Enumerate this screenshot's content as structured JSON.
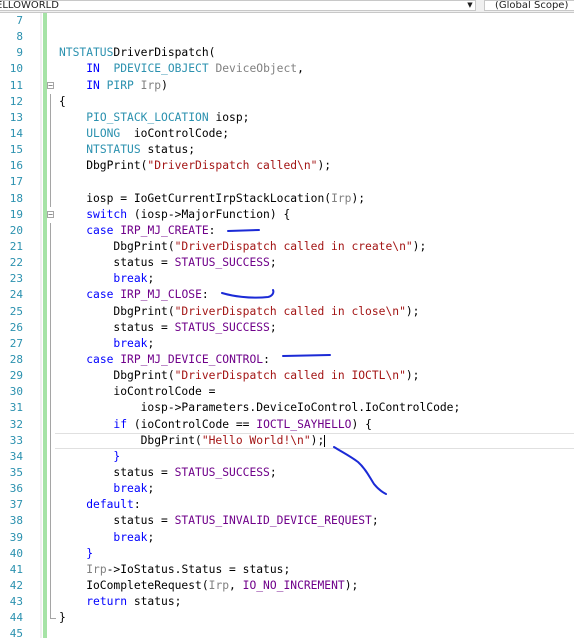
{
  "toolbar": {
    "scope_dropdown": "ELLOWORLD",
    "member_dropdown": "(Global Scope)"
  },
  "editor": {
    "line_numbers": [
      "7",
      "8",
      "9",
      "10",
      "11",
      "12",
      "13",
      "14",
      "15",
      "16",
      "17",
      "18",
      "19",
      "20",
      "21",
      "22",
      "23",
      "24",
      "25",
      "26",
      "27",
      "28",
      "29",
      "30",
      "31",
      "32",
      "33",
      "34",
      "35",
      "36",
      "37",
      "38",
      "39",
      "40",
      "41",
      "42",
      "43",
      "44",
      "45"
    ],
    "lines": [
      [],
      [],
      [
        [
          "ty",
          "NTSTATUS"
        ],
        [
          "",
          "DriverDispatch("
        ]
      ],
      [
        [
          "",
          "    "
        ],
        [
          "kw",
          "IN"
        ],
        [
          "",
          ""
        ],
        [
          "",
          "  "
        ],
        [
          "ty",
          "PDEVICE_OBJECT"
        ],
        [
          "",
          ""
        ],
        [
          "pa",
          " DeviceObject"
        ],
        [
          "",
          ","
        ]
      ],
      [
        [
          "",
          "    "
        ],
        [
          "kw",
          "IN"
        ],
        [
          "",
          ""
        ],
        [
          "ty",
          " PIRP"
        ],
        [
          "pa",
          " Irp"
        ],
        [
          "",
          ")"
        ]
      ],
      [
        [
          "",
          "{"
        ]
      ],
      [
        [
          "",
          "    "
        ],
        [
          "ty",
          "PIO_STACK_LOCATION"
        ],
        [
          "",
          " iosp;"
        ]
      ],
      [
        [
          "",
          "    "
        ],
        [
          "ty",
          "ULONG"
        ],
        [
          "",
          "  ioControlCode;"
        ]
      ],
      [
        [
          "",
          "    "
        ],
        [
          "ty",
          "NTSTATUS"
        ],
        [
          "",
          " status;"
        ]
      ],
      [
        [
          "",
          "    DbgPrint("
        ],
        [
          "st",
          "\"DriverDispatch called\\n\""
        ],
        [
          "",
          ");"
        ]
      ],
      [],
      [
        [
          "",
          "    iosp = IoGetCurrentIrpStackLocation("
        ],
        [
          "pa",
          "Irp"
        ],
        [
          "",
          ");"
        ]
      ],
      [
        [
          "",
          "    "
        ],
        [
          "kw",
          "switch"
        ],
        [
          "",
          " (iosp->MajorFunction) {"
        ]
      ],
      [
        [
          "",
          "    "
        ],
        [
          "kw",
          "case"
        ],
        [
          "",
          " "
        ],
        [
          "pr",
          "IRP_MJ_CREATE"
        ],
        [
          "",
          ":"
        ]
      ],
      [
        [
          "",
          "        DbgPrint("
        ],
        [
          "st",
          "\"DriverDispatch called in create\\n\""
        ],
        [
          "",
          ");"
        ]
      ],
      [
        [
          "",
          "        status = "
        ],
        [
          "pr",
          "STATUS_SUCCESS"
        ],
        [
          "",
          ";"
        ]
      ],
      [
        [
          "",
          "        "
        ],
        [
          "kw",
          "break"
        ],
        [
          "",
          ";"
        ]
      ],
      [
        [
          "",
          "    "
        ],
        [
          "kw",
          "case"
        ],
        [
          "",
          " "
        ],
        [
          "pr",
          "IRP_MJ_CLOSE"
        ],
        [
          "",
          ":"
        ]
      ],
      [
        [
          "",
          "        DbgPrint("
        ],
        [
          "st",
          "\"DriverDispatch called in close\\n\""
        ],
        [
          "",
          ");"
        ]
      ],
      [
        [
          "",
          "        status = "
        ],
        [
          "pr",
          "STATUS_SUCCESS"
        ],
        [
          "",
          ";"
        ]
      ],
      [
        [
          "",
          "        "
        ],
        [
          "kw",
          "break"
        ],
        [
          "",
          ";"
        ]
      ],
      [
        [
          "",
          "    "
        ],
        [
          "kw",
          "case"
        ],
        [
          "",
          " "
        ],
        [
          "pr",
          "IRP_MJ_DEVICE_CONTROL"
        ],
        [
          "",
          ":"
        ]
      ],
      [
        [
          "",
          "        DbgPrint("
        ],
        [
          "st",
          "\"DriverDispatch called in IOCTL\\n\""
        ],
        [
          "",
          ");"
        ]
      ],
      [
        [
          "",
          "        ioControlCode ="
        ]
      ],
      [
        [
          "",
          "            iosp->Parameters.DeviceIoControl.IoControlCode;"
        ]
      ],
      [
        [
          "",
          "        "
        ],
        [
          "kw",
          "if"
        ],
        [
          "",
          " (ioControlCode == "
        ],
        [
          "pr",
          "IOCTL_SAYHELLO"
        ],
        [
          "",
          ") {"
        ]
      ],
      [
        [
          "",
          "            DbgPrint("
        ],
        [
          "st",
          "\"Hello World!\\n\""
        ],
        [
          "",
          ");"
        ]
      ],
      [
        [
          "",
          "        "
        ],
        [
          "kw",
          "}"
        ]
      ],
      [
        [
          "",
          "        status = "
        ],
        [
          "pr",
          "STATUS_SUCCESS"
        ],
        [
          "",
          ";"
        ]
      ],
      [
        [
          "",
          "        "
        ],
        [
          "kw",
          "break"
        ],
        [
          "",
          ";"
        ]
      ],
      [
        [
          "",
          "    "
        ],
        [
          "kw",
          "default"
        ],
        [
          "",
          ":"
        ]
      ],
      [
        [
          "",
          "        status = "
        ],
        [
          "pr",
          "STATUS_INVALID_DEVICE_REQUEST"
        ],
        [
          "",
          ";"
        ]
      ],
      [
        [
          "",
          "        "
        ],
        [
          "kw",
          "break"
        ],
        [
          "",
          ";"
        ]
      ],
      [
        [
          "",
          "    "
        ],
        [
          "kw",
          "}"
        ]
      ],
      [
        [
          "",
          "    "
        ],
        [
          "pa",
          "Irp"
        ],
        [
          "",
          "->IoStatus.Status = status;"
        ]
      ],
      [
        [
          "",
          "    IoCompleteRequest("
        ],
        [
          "pa",
          "Irp"
        ],
        [
          "",
          ", "
        ],
        [
          "pr",
          "IO_NO_INCREMENT"
        ],
        [
          "",
          ");"
        ]
      ],
      [
        [
          "",
          "    "
        ],
        [
          "kw",
          "return"
        ],
        [
          "",
          " status;"
        ]
      ],
      [
        [
          "",
          "}"
        ]
      ],
      []
    ]
  }
}
